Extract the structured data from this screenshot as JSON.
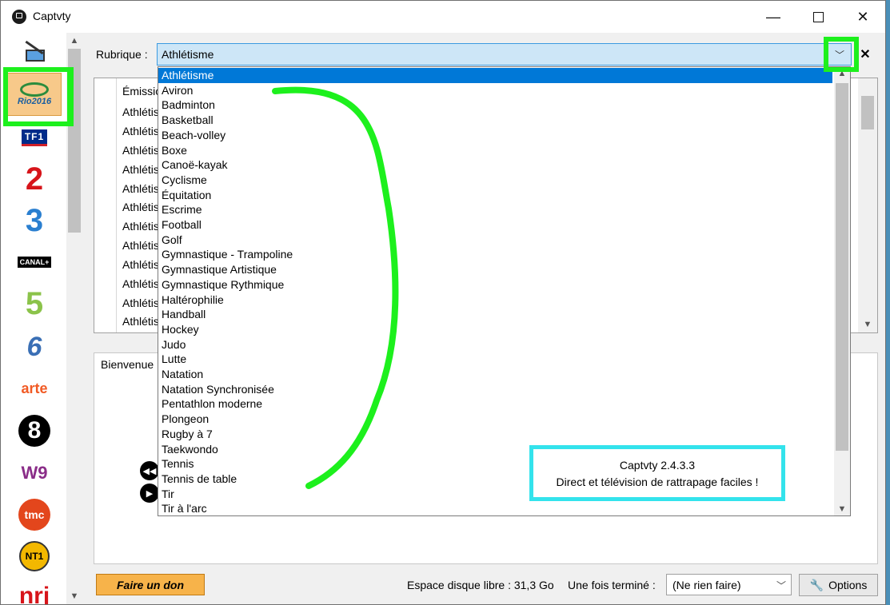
{
  "window": {
    "title": "Captvty"
  },
  "controls": {
    "minimize": "—",
    "close": "✕"
  },
  "channels": [
    {
      "name": "wand",
      "label": ""
    },
    {
      "name": "rio2016",
      "label": "Rio2016"
    },
    {
      "name": "tf1",
      "label": "TF1"
    },
    {
      "name": "france2",
      "label": "2"
    },
    {
      "name": "france3",
      "label": "3"
    },
    {
      "name": "canalplus",
      "label": "CANAL+"
    },
    {
      "name": "france5",
      "label": "5"
    },
    {
      "name": "m6",
      "label": "6"
    },
    {
      "name": "arte",
      "label": "arte"
    },
    {
      "name": "c8",
      "label": "8"
    },
    {
      "name": "w9",
      "label": "W9"
    },
    {
      "name": "tmc",
      "label": "tmc"
    },
    {
      "name": "nt1",
      "label": "NT1"
    },
    {
      "name": "nrj",
      "label": "nrj"
    }
  ],
  "rubrique": {
    "label": "Rubrique :",
    "value": "Athlétisme",
    "chevron": "﹀",
    "clear": "✕"
  },
  "main_list": {
    "header": "Émissio",
    "rows": [
      "Athlétis",
      "Athlétis",
      "Athlétis",
      "Athlétis",
      "Athlétis",
      "Athlétis",
      "Athlétis",
      "Athlétis",
      "Athlétis",
      "Athlétis",
      "Athlétis",
      "Athlétis"
    ]
  },
  "dropdown": {
    "items": [
      "Athlétisme",
      "Aviron",
      "Badminton",
      "Basketball",
      "Beach-volley",
      "Boxe",
      "Canoë-kayak",
      "Cyclisme",
      "Équitation",
      "Escrime",
      "Football",
      "Golf",
      "Gymnastique - Trampoline",
      "Gymnastique Artistique",
      "Gymnastique Rythmique",
      "Haltérophilie",
      "Handball",
      "Hockey",
      "Judo",
      "Lutte",
      "Natation",
      "Natation Synchronisée",
      "Pentathlon moderne",
      "Plongeon",
      "Rugby à 7",
      "Taekwondo",
      "Tennis",
      "Tennis de table",
      "Tir",
      "Tir à l'arc"
    ],
    "selected_index": 0
  },
  "bottom": {
    "tab": "Bienvenue"
  },
  "version": {
    "line1": "Captvty 2.4.3.3",
    "line2": "Direct et télévision de rattrapage faciles !"
  },
  "footer": {
    "donate": "Faire un don",
    "disk": "Espace disque libre : 31,3 Go",
    "when_label": "Une fois terminé :",
    "when_value": "(Ne rien faire)",
    "options": "Options"
  },
  "colors": {
    "accent": "#0078d7",
    "annotation_green": "#1df01d",
    "annotation_cyan": "#33e3ec"
  }
}
